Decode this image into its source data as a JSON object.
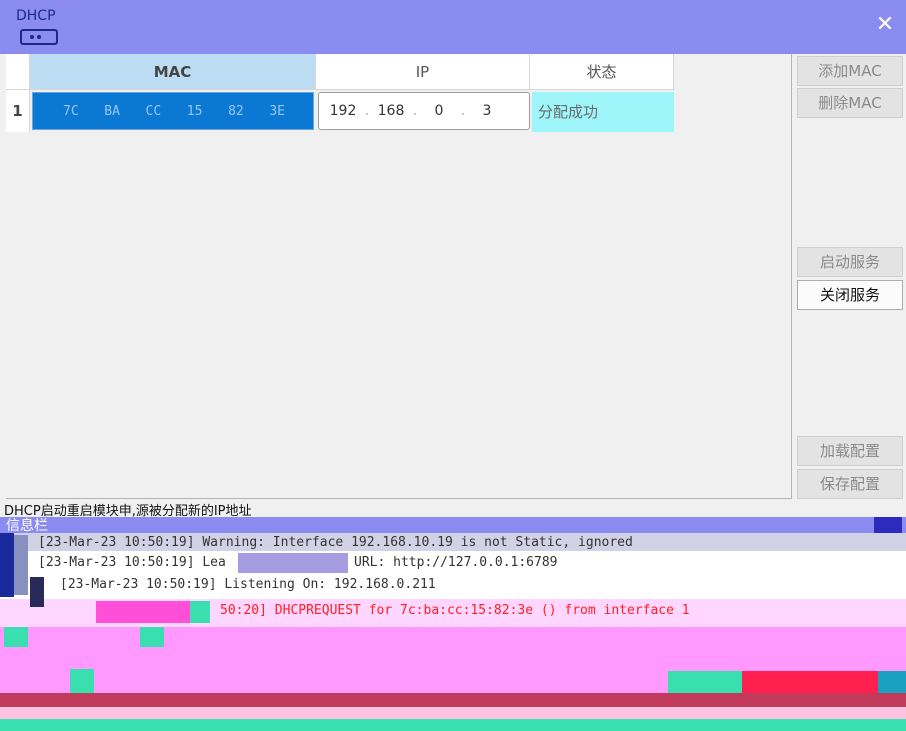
{
  "window": {
    "title": "DHCP",
    "close_glyph": "✕"
  },
  "table": {
    "headers": {
      "mac": "MAC",
      "ip": "IP",
      "status": "状态"
    },
    "rows": [
      {
        "index": "1",
        "mac": [
          "7C",
          "BA",
          "CC",
          "15",
          "82",
          "3E"
        ],
        "ip": [
          "192",
          "168",
          "0",
          "3"
        ],
        "ip_separator": ".",
        "status": "分配成功"
      }
    ]
  },
  "buttons": {
    "add_mac": "添加MAC",
    "delete_mac": "删除MAC",
    "start_service": "启动服务",
    "stop_service": "关闭服务",
    "load_config": "加载配置",
    "save_config": "保存配置"
  },
  "status_line": "DHCP启动重启模块申,源被分配新的IP地址",
  "log": {
    "title": "信息栏",
    "lines": [
      "[23-Mar-23 10:50:19] Warning: Interface 192.168.10.19 is not Static, ignored",
      "[23-Mar-23 10:50:19] Lea",
      "URL: http://127.0.0.1:6789",
      "[23-Mar-23 10:50:19] Listening On: 192.168.0.211",
      "50:20] DHCPREQUEST for 7c:ba:cc:15:82:3e () from interface 1"
    ]
  },
  "colors": {
    "title_bar": "#8b8cf2",
    "selected_cell": "#0b78d4",
    "status_cell": "#9ef6fb",
    "log_bg": "#ff99ff",
    "log_error_text": "#ff2020"
  },
  "icons": {
    "app": "router-icon",
    "close": "close-icon"
  }
}
